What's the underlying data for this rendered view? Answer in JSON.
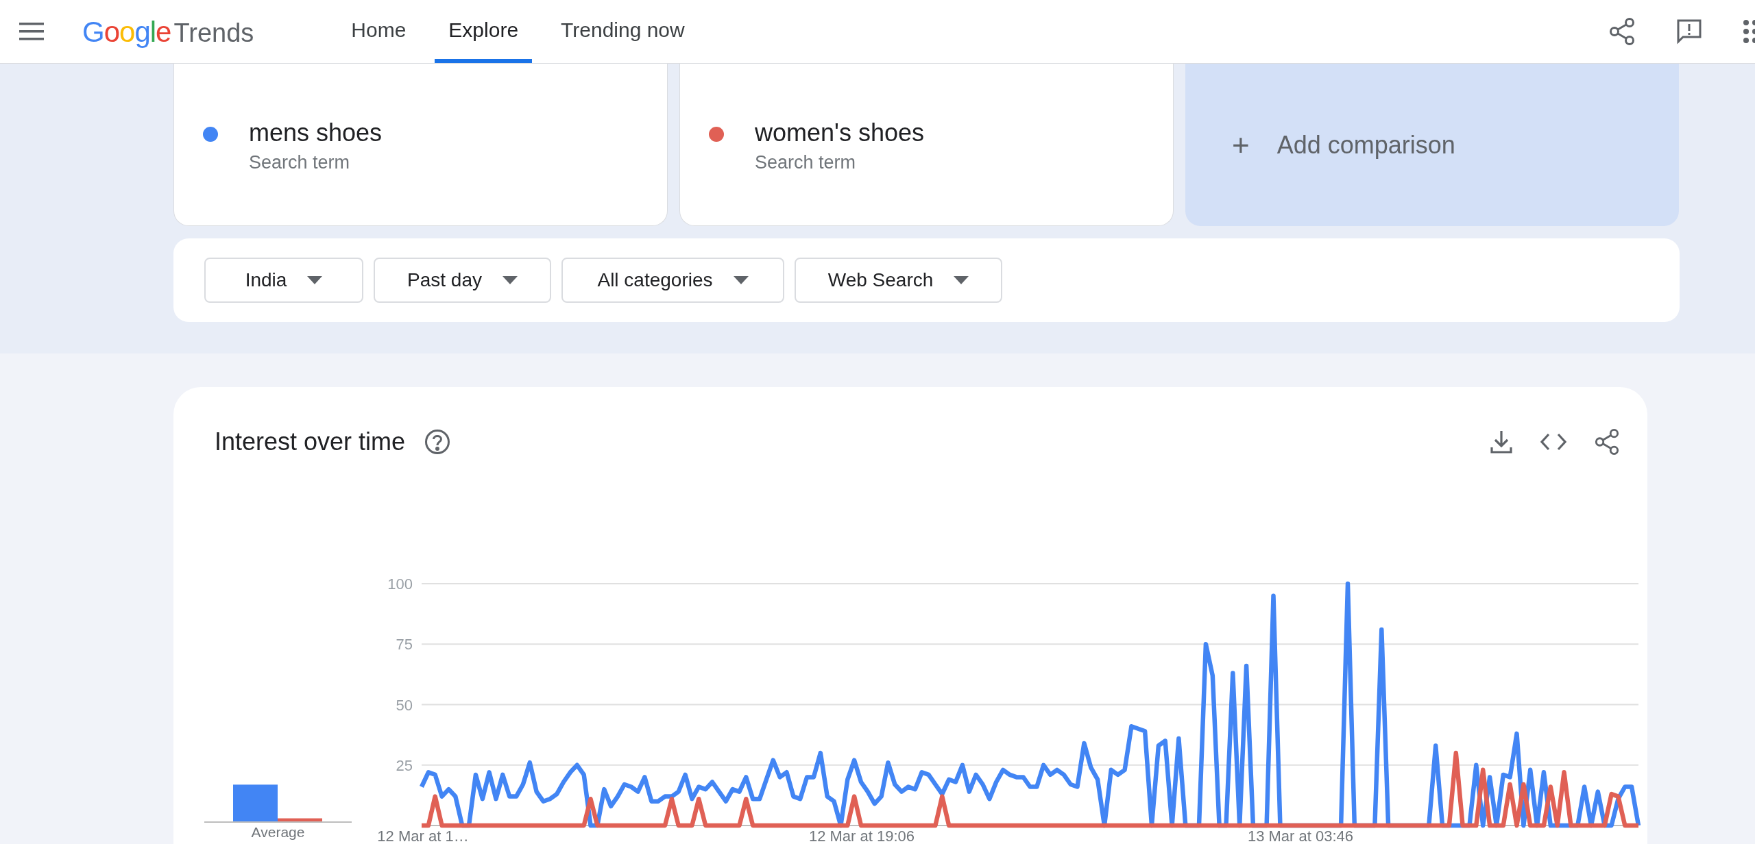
{
  "header": {
    "logo": {
      "brand": "Google",
      "product": "Trends"
    },
    "nav": [
      {
        "label": "Home",
        "selected": false
      },
      {
        "label": "Explore",
        "selected": true
      },
      {
        "label": "Trending now",
        "selected": false
      }
    ]
  },
  "terms": [
    {
      "label": "mens shoes",
      "sublabel": "Search term",
      "color": "#4285f4"
    },
    {
      "label": "women's shoes",
      "sublabel": "Search term",
      "color": "#e06055"
    }
  ],
  "add_comparison": {
    "icon": "+",
    "label": "Add comparison"
  },
  "filters": [
    {
      "label": "India"
    },
    {
      "label": "Past day"
    },
    {
      "label": "All categories"
    },
    {
      "label": "Web Search"
    }
  ],
  "interest_over_time": {
    "title": "Interest over time",
    "average_label": "Average",
    "x_labels": [
      "12 Mar at 1…",
      "12 Mar at 19:06",
      "13 Mar at 03:46"
    ],
    "chart_data": {
      "type": "line",
      "ylim": [
        0,
        100
      ],
      "yticks": [
        25,
        50,
        75,
        100
      ],
      "grid": true,
      "series": [
        {
          "color": "#4285f4",
          "values": [
            16,
            22,
            21,
            12,
            15,
            12,
            0,
            0,
            21,
            11,
            22,
            11,
            21,
            12,
            12,
            17,
            26,
            14,
            10,
            11,
            13,
            18,
            22,
            25,
            21,
            0,
            0,
            15,
            8,
            12,
            17,
            16,
            14,
            20,
            10,
            10,
            12,
            12,
            14,
            21,
            11,
            16,
            15,
            18,
            14,
            10,
            15,
            14,
            20,
            11,
            11,
            19,
            27,
            20,
            22,
            12,
            11,
            20,
            20,
            30,
            12,
            10,
            0,
            19,
            27,
            18,
            14,
            9,
            12,
            26,
            17,
            14,
            16,
            15,
            22,
            21,
            17,
            13,
            19,
            18,
            25,
            14,
            21,
            17,
            11,
            18,
            23,
            21,
            20,
            20,
            16,
            16,
            25,
            21,
            23,
            21,
            17,
            16,
            34,
            24,
            19,
            0,
            23,
            21,
            23,
            41,
            40,
            39,
            0,
            33,
            35,
            0,
            36,
            0,
            0,
            0,
            75,
            62,
            0,
            0,
            63,
            0,
            66,
            0,
            0,
            0,
            95,
            0,
            0,
            0,
            0,
            0,
            0,
            0,
            0,
            0,
            0,
            100,
            0,
            0,
            0,
            0,
            81,
            0,
            0,
            0,
            0,
            0,
            0,
            0,
            33,
            0,
            0,
            0,
            0,
            0,
            25,
            0,
            20,
            0,
            21,
            20,
            38,
            0,
            23,
            0,
            22,
            0,
            0,
            0,
            0,
            0,
            16,
            0,
            14,
            0,
            0,
            11,
            16,
            16,
            0
          ]
        },
        {
          "color": "#e06055",
          "values": [
            0,
            0,
            12,
            0,
            0,
            0,
            0,
            0,
            0,
            0,
            0,
            0,
            0,
            0,
            0,
            0,
            0,
            0,
            0,
            0,
            0,
            0,
            0,
            0,
            0,
            11,
            0,
            0,
            0,
            0,
            0,
            0,
            0,
            0,
            0,
            0,
            0,
            11,
            0,
            0,
            0,
            11,
            0,
            0,
            0,
            0,
            0,
            0,
            11,
            0,
            0,
            0,
            0,
            0,
            0,
            0,
            0,
            0,
            0,
            0,
            0,
            0,
            0,
            0,
            12,
            0,
            0,
            0,
            0,
            0,
            0,
            0,
            0,
            0,
            0,
            0,
            0,
            12,
            0,
            0,
            0,
            0,
            0,
            0,
            0,
            0,
            0,
            0,
            0,
            0,
            0,
            0,
            0,
            0,
            0,
            0,
            0,
            0,
            0,
            0,
            0,
            0,
            0,
            0,
            0,
            0,
            0,
            0,
            0,
            0,
            0,
            0,
            0,
            0,
            0,
            0,
            0,
            0,
            0,
            0,
            0,
            0,
            0,
            0,
            0,
            0,
            0,
            0,
            0,
            0,
            0,
            0,
            0,
            0,
            0,
            0,
            0,
            0,
            0,
            0,
            0,
            0,
            0,
            0,
            0,
            0,
            0,
            0,
            0,
            0,
            0,
            0,
            0,
            30,
            0,
            0,
            0,
            23,
            0,
            0,
            0,
            17,
            0,
            17,
            0,
            0,
            0,
            16,
            0,
            22,
            0,
            0,
            0,
            0,
            0,
            0,
            13,
            12,
            0,
            0,
            0
          ]
        }
      ]
    }
  }
}
